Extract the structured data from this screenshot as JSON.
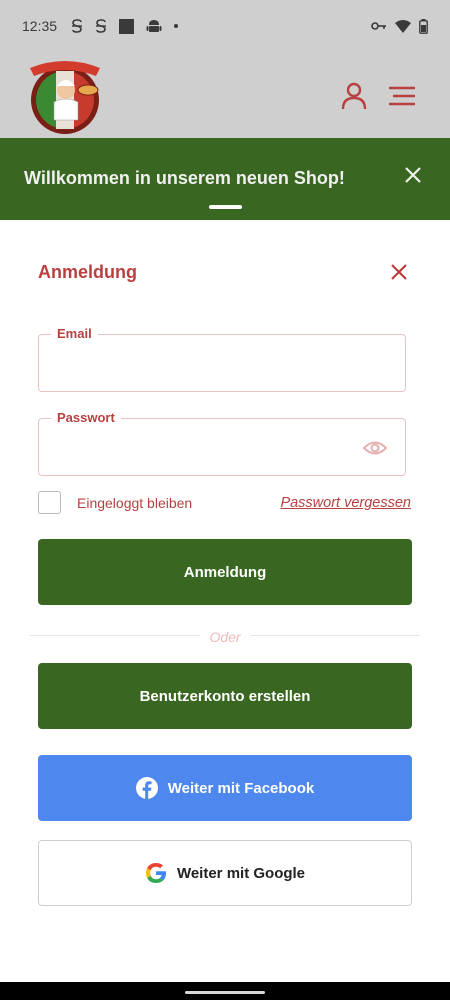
{
  "status_bar": {
    "time": "12:35",
    "icons_left": [
      "s-icon",
      "s-icon",
      "square-icon",
      "android-icon",
      "dot-icon"
    ],
    "icons_right": [
      "key-icon",
      "wifi-icon",
      "battery-icon"
    ]
  },
  "header": {
    "logo_alt": "Da Luigi",
    "user_icon": "user-icon",
    "menu_icon": "hamburger-icon"
  },
  "banner": {
    "text": "Willkommen in unserem neuen Shop!",
    "close_icon": "close-icon"
  },
  "login": {
    "title": "Anmeldung",
    "email": {
      "label": "Email",
      "value": "",
      "placeholder": ""
    },
    "password": {
      "label": "Passwort",
      "value": "",
      "placeholder": ""
    },
    "remember_label": "Eingeloggt bleiben",
    "forgot_label": "Passwort vergessen",
    "submit_label": "Anmeldung",
    "divider_label": "Oder",
    "register_label": "Benutzerkonto erstellen",
    "facebook_label": "Weiter mit Facebook",
    "google_label": "Weiter mit Google"
  },
  "colors": {
    "brand_green": "#396620",
    "accent_red": "#b84040",
    "facebook_blue": "#4e87ed"
  }
}
